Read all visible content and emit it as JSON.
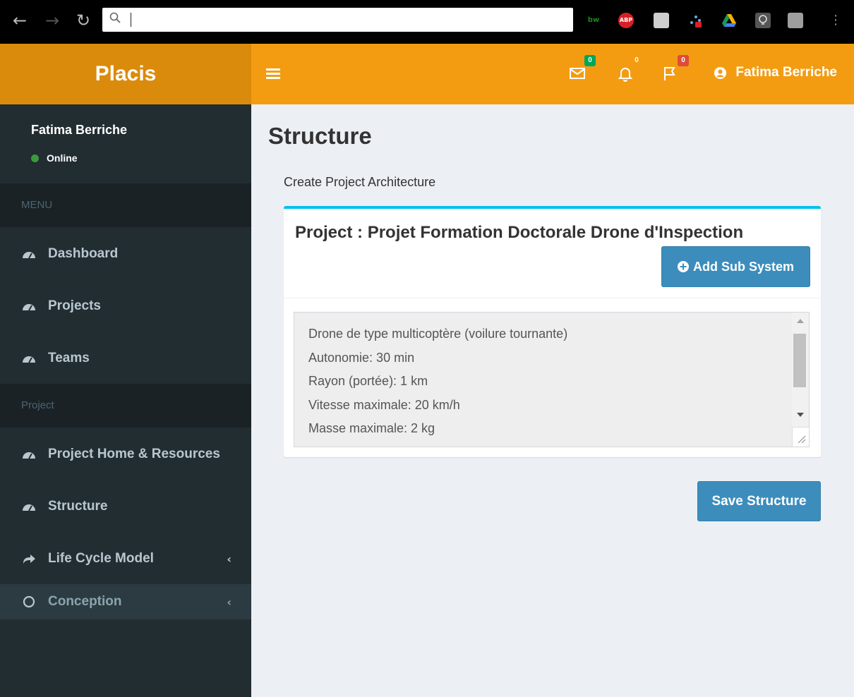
{
  "browser": {
    "address_value": "",
    "extensions": [
      {
        "name": "bw-icon",
        "label": "bw",
        "color": "#1a6b1a"
      },
      {
        "name": "adblock-icon",
        "label": "ABP",
        "color": "#d91f26"
      },
      {
        "name": "doc-icon",
        "label": "",
        "color": "#cfcfcf"
      },
      {
        "name": "network-icon",
        "label": "",
        "color": "#1f5fa8"
      },
      {
        "name": "drive-icon",
        "label": "",
        "color": "#f4b400"
      },
      {
        "name": "lightbulb-icon",
        "label": "",
        "color": "#888888"
      },
      {
        "name": "ext-icon",
        "label": "",
        "color": "#9e9e9e"
      }
    ]
  },
  "app": {
    "brand": "Placis"
  },
  "header": {
    "messages_count": "0",
    "notifications_count": "0",
    "flags_count": "0",
    "user_name": "Fatima Berriche"
  },
  "sidebar": {
    "user_name": "Fatima Berriche",
    "status": "Online",
    "menu_header": "MENU",
    "menu_items": [
      {
        "label": "Dashboard"
      },
      {
        "label": "Projects"
      },
      {
        "label": "Teams"
      }
    ],
    "project_header": "Project",
    "project_items": [
      {
        "label": "Project Home & Resources"
      },
      {
        "label": "Structure"
      },
      {
        "label": "Life Cycle Model"
      },
      {
        "label": "Conception"
      }
    ]
  },
  "main": {
    "title": "Structure",
    "section_label": "Create Project Architecture",
    "project_title": "Project : Projet Formation Doctorale Drone d'Inspection",
    "add_button": "Add Sub System",
    "description_lines": [
      "Drone de type multicoptère (voilure tournante)",
      "Autonomie: 30 min",
      "Rayon (portée): 1 km",
      "Vitesse maximale: 20 km/h",
      "Masse maximale: 2 kg"
    ],
    "save_button": "Save Structure"
  },
  "colors": {
    "header_orange": "#f39c12",
    "brand_orange": "#db8b0b",
    "sidebar_bg": "#222d32",
    "primary_blue": "#3c8dbc",
    "box_accent": "#00c0ef",
    "badge_green": "#00a65a",
    "badge_red": "#dd4b39"
  }
}
